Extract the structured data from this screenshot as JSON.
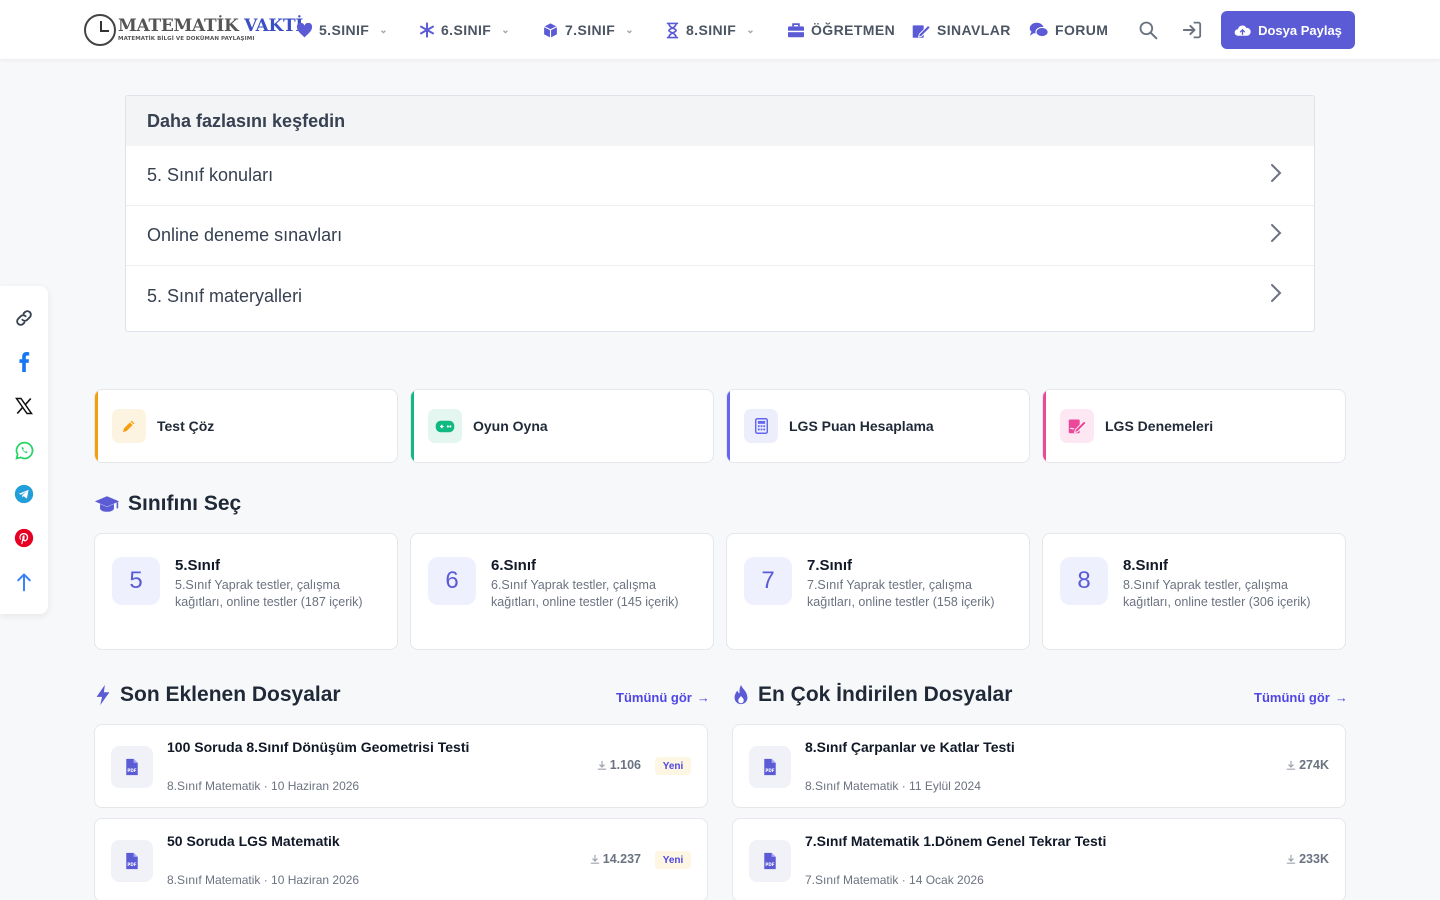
{
  "header": {
    "logo": {
      "text_main": "MATEMATİK",
      "text_accent": "VAKTİ",
      "tagline": "MATEMATİK BİLGİ VE DOKÜMAN PAYLAŞIMI"
    },
    "nav": [
      {
        "label": "5.SINIF",
        "icon": "heart-icon",
        "has_dropdown": true
      },
      {
        "label": "6.SINIF",
        "icon": "asterisk-icon",
        "has_dropdown": true
      },
      {
        "label": "7.SINIF",
        "icon": "cube-icon",
        "has_dropdown": true
      },
      {
        "label": "8.SINIF",
        "icon": "hourglass-icon",
        "has_dropdown": true
      },
      {
        "label": "ÖĞRETMEN",
        "icon": "briefcase-icon",
        "has_dropdown": false
      },
      {
        "label": "SINAVLAR",
        "icon": "edit-icon",
        "has_dropdown": false
      },
      {
        "label": "FORUM",
        "icon": "chat-icon",
        "has_dropdown": false
      }
    ],
    "share_button": "Dosya Paylaş",
    "accent_color": "#5b5bd6"
  },
  "share_rail": [
    "link-icon",
    "facebook-icon",
    "x-icon",
    "whatsapp-icon",
    "telegram-icon",
    "pinterest-icon",
    "arrow-up-icon"
  ],
  "discover": {
    "title": "Daha fazlasını keşfedin",
    "items": [
      "5. Sınıf konuları",
      "Online deneme sınavları",
      "5. Sınıf materyalleri"
    ]
  },
  "quick_actions": [
    {
      "label": "Test Çöz",
      "icon": "pencil-icon",
      "color": "#f59e0b"
    },
    {
      "label": "Oyun Oyna",
      "icon": "gamepad-icon",
      "color": "#10b981"
    },
    {
      "label": "LGS Puan Hesaplama",
      "icon": "calculator-icon",
      "color": "#6366f1"
    },
    {
      "label": "LGS Denemeleri",
      "icon": "signature-icon",
      "color": "#ec4899"
    }
  ],
  "grades": {
    "title": "Sınıfını Seç",
    "items": [
      {
        "num": "5",
        "title": "5.Sınıf",
        "desc": "5.Sınıf Yaprak testler, çalışma kağıtları, online testler (187 içerik)"
      },
      {
        "num": "6",
        "title": "6.Sınıf",
        "desc": "6.Sınıf Yaprak testler, çalışma kağıtları, online testler (145 içerik)"
      },
      {
        "num": "7",
        "title": "7.Sınıf",
        "desc": "7.Sınıf Yaprak testler, çalışma kağıtları, online testler (158 içerik)"
      },
      {
        "num": "8",
        "title": "8.Sınıf",
        "desc": "8.Sınıf Yaprak testler, çalışma kağıtları, online testler (306 içerik)"
      }
    ]
  },
  "recent": {
    "title": "Son Eklenen Dosyalar",
    "see_all": "Tümünü gör",
    "items": [
      {
        "title": "100 Soruda 8.Sınıf Dönüşüm Geometrisi Testi",
        "meta": "8.Sınıf Matematik · 10 Haziran 2026",
        "downloads": "1.106",
        "badge": "Yeni"
      },
      {
        "title": "50 Soruda LGS Matematik",
        "meta": "8.Sınıf Matematik · 10 Haziran 2026",
        "downloads": "14.237",
        "badge": "Yeni"
      }
    ]
  },
  "popular": {
    "title": "En Çok İndirilen Dosyalar",
    "see_all": "Tümünü gör",
    "items": [
      {
        "title": "8.Sınıf Çarpanlar ve Katlar Testi",
        "meta": "8.Sınıf Matematik · 11 Eylül 2024",
        "downloads": "274K"
      },
      {
        "title": "7.Sınıf Matematik 1.Dönem Genel Tekrar Testi",
        "meta": "7.Sınıf Matematik · 14 Ocak 2026",
        "downloads": "233K"
      }
    ]
  }
}
